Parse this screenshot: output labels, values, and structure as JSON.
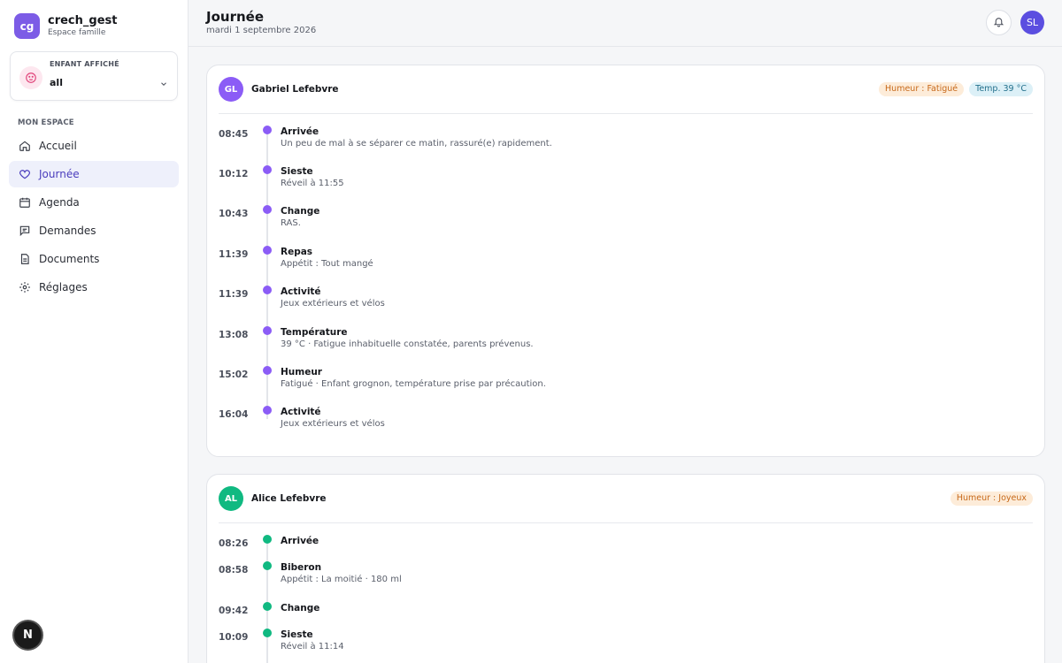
{
  "brand": {
    "logo": "cg",
    "name": "crech_gest",
    "subtitle": "Espace famille"
  },
  "child_selector": {
    "label": "ENFANT AFFICHÉ",
    "value": "all"
  },
  "nav": {
    "section_label": "MON ESPACE",
    "items": [
      {
        "label": "Accueil",
        "icon": "home-icon"
      },
      {
        "label": "Journée",
        "icon": "heart-icon",
        "active": true
      },
      {
        "label": "Agenda",
        "icon": "calendar-icon"
      },
      {
        "label": "Demandes",
        "icon": "message-icon"
      },
      {
        "label": "Documents",
        "icon": "file-icon"
      },
      {
        "label": "Réglages",
        "icon": "gear-icon"
      }
    ]
  },
  "footer_badge": "N",
  "header": {
    "title": "Journée",
    "date": "mardi 1 septembre 2026",
    "user_initials": "SL"
  },
  "colors": {
    "accent": "#5b4ee0",
    "purple": "#8b5cf6",
    "green": "#10b981"
  },
  "cards": [
    {
      "initials": "GL",
      "name": "Gabriel Lefebvre",
      "badges": [
        {
          "text": "Humeur : Fatigué",
          "tone": "orange"
        },
        {
          "text": "Temp. 39 °C",
          "tone": "blue"
        }
      ],
      "events": [
        {
          "time": "08:45",
          "title": "Arrivée",
          "desc": "Un peu de mal à se séparer ce matin, rassuré(e) rapidement."
        },
        {
          "time": "10:12",
          "title": "Sieste",
          "desc": "Réveil à 11:55"
        },
        {
          "time": "10:43",
          "title": "Change",
          "desc": "RAS."
        },
        {
          "time": "11:39",
          "title": "Repas",
          "desc": "Appétit : Tout mangé"
        },
        {
          "time": "11:39",
          "title": "Activité",
          "desc": "Jeux extérieurs et vélos"
        },
        {
          "time": "13:08",
          "title": "Température",
          "desc": "39 °C · Fatigue inhabituelle constatée, parents prévenus."
        },
        {
          "time": "15:02",
          "title": "Humeur",
          "desc": "Fatigué · Enfant grognon, température prise par précaution."
        },
        {
          "time": "16:04",
          "title": "Activité",
          "desc": "Jeux extérieurs et vélos"
        }
      ]
    },
    {
      "initials": "AL",
      "name": "Alice Lefebvre",
      "badges": [
        {
          "text": "Humeur : Joyeux",
          "tone": "orange"
        }
      ],
      "events": [
        {
          "time": "08:26",
          "title": "Arrivée",
          "desc": ""
        },
        {
          "time": "08:58",
          "title": "Biberon",
          "desc": "Appétit : La moitié · 180 ml"
        },
        {
          "time": "09:42",
          "title": "Change",
          "desc": ""
        },
        {
          "time": "10:09",
          "title": "Sieste",
          "desc": "Réveil à 11:14"
        }
      ]
    }
  ]
}
